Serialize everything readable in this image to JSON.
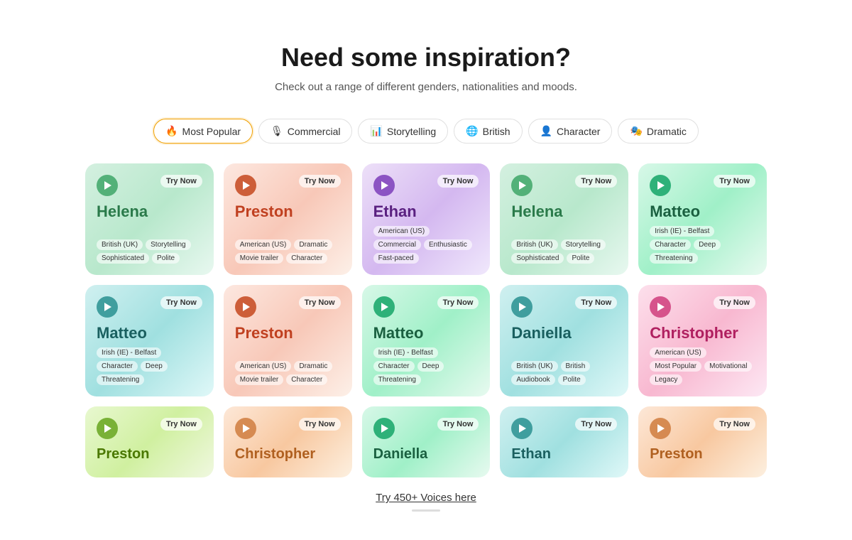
{
  "header": {
    "title": "Need some inspiration?",
    "subtitle": "Check out a range of different genders, nationalities and moods."
  },
  "filters": [
    {
      "id": "most-popular",
      "label": "Most Popular",
      "icon": "🔥",
      "active": true
    },
    {
      "id": "commercial",
      "label": "Commercial",
      "icon": "🎙",
      "active": false
    },
    {
      "id": "storytelling",
      "label": "Storytelling",
      "icon": "📊",
      "active": false
    },
    {
      "id": "british",
      "label": "British",
      "icon": "🌐",
      "active": false
    },
    {
      "id": "character",
      "label": "Character",
      "icon": "👤",
      "active": false
    },
    {
      "id": "dramatic",
      "label": "Dramatic",
      "icon": "🎭",
      "active": false
    }
  ],
  "try_now_label": "Try Now",
  "bottom_link": "Try 450+ Voices here",
  "cards_row1": [
    {
      "name": "Helena",
      "color": "green",
      "tags": [
        "British (UK)",
        "Storytelling",
        "Sophisticated",
        "Polite"
      ]
    },
    {
      "name": "Preston",
      "color": "red",
      "tags": [
        "American (US)",
        "Dramatic",
        "Movie trailer",
        "Character"
      ]
    },
    {
      "name": "Ethan",
      "color": "purple",
      "tags": [
        "American (US)",
        "Commercial",
        "Enthusiastic",
        "Fast-paced"
      ]
    },
    {
      "name": "Helena",
      "color": "green",
      "tags": [
        "British (UK)",
        "Storytelling",
        "Sophisticated",
        "Polite"
      ]
    },
    {
      "name": "Matteo",
      "color": "mint",
      "tags": [
        "Irish (IE) - Belfast",
        "Character",
        "Deep",
        "Threatening"
      ]
    }
  ],
  "cards_row2": [
    {
      "name": "Matteo",
      "color": "teal",
      "tags": [
        "Irish (IE) - Belfast",
        "Character",
        "Deep",
        "Threatening"
      ]
    },
    {
      "name": "Preston",
      "color": "red",
      "tags": [
        "American (US)",
        "Dramatic",
        "Movie trailer",
        "Character"
      ]
    },
    {
      "name": "Matteo",
      "color": "mint",
      "tags": [
        "Irish (IE) - Belfast",
        "Character",
        "Deep",
        "Threatening"
      ]
    },
    {
      "name": "Daniella",
      "color": "teal",
      "tags": [
        "British (UK)",
        "British",
        "Audiobook",
        "Polite"
      ]
    },
    {
      "name": "Christopher",
      "color": "pink",
      "tags": [
        "American (US)",
        "Most Popular",
        "Motivational",
        "Legacy"
      ]
    }
  ],
  "cards_row3": [
    {
      "name": "Preston",
      "color": "yellow-green",
      "tags": []
    },
    {
      "name": "Christopher",
      "color": "salmon",
      "tags": []
    },
    {
      "name": "Daniella",
      "color": "mint",
      "tags": []
    },
    {
      "name": "Ethan",
      "color": "teal",
      "tags": []
    },
    {
      "name": "Preston",
      "color": "salmon",
      "tags": []
    }
  ]
}
